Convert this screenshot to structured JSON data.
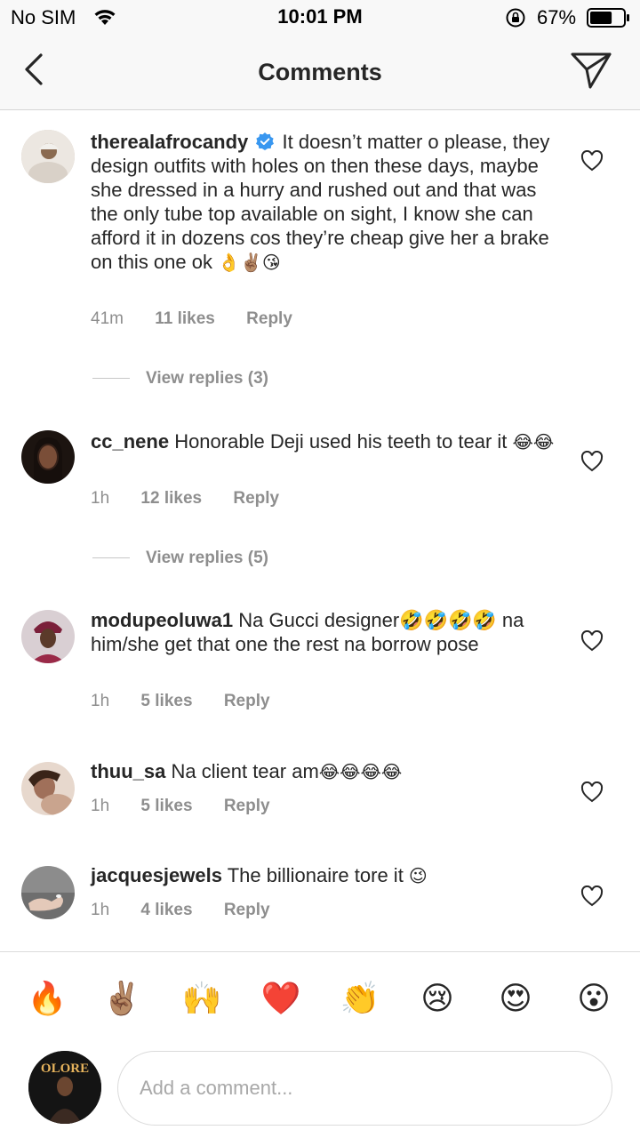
{
  "status_bar": {
    "carrier": "No SIM",
    "time": "10:01 PM",
    "battery": "67%",
    "battery_level": 0.67
  },
  "nav": {
    "title": "Comments",
    "back_icon": "chevron-left-icon",
    "send_icon": "paper-plane-icon"
  },
  "comments": [
    {
      "username": "therealafrocandy",
      "verified": true,
      "text": "It doesn’t matter o please, they design outfits with holes on then these days, maybe she dressed in a hurry and rushed out and that was the only tube top available on sight, I know she can afford it in dozens cos they’re cheap give her a brake on this one ok ",
      "emoji": "👌✌🏽😘",
      "time": "41m",
      "likes": "11 likes",
      "reply_label": "Reply",
      "view_replies": "View replies (3)"
    },
    {
      "username": "cc_nene",
      "verified": false,
      "text": "Honorable Deji used his teeth to tear it ",
      "emoji": "😂😂",
      "time": "1h",
      "likes": "12 likes",
      "reply_label": "Reply",
      "view_replies": "View replies (5)"
    },
    {
      "username": "modupeoluwa1",
      "verified": false,
      "text": "Na Gucci designer🤣🤣🤣🤣 na him/she get that one the rest na borrow pose",
      "emoji": "",
      "time": "1h",
      "likes": "5 likes",
      "reply_label": "Reply"
    },
    {
      "username": "thuu_sa",
      "verified": false,
      "text": "Na client tear am",
      "emoji": "😂😂😂😂",
      "time": "1h",
      "likes": "5 likes",
      "reply_label": "Reply"
    },
    {
      "username": "jacquesjewels",
      "verified": false,
      "text": "The billionaire tore it ",
      "emoji": "😉",
      "time": "1h",
      "likes": "4 likes",
      "reply_label": "Reply"
    }
  ],
  "emoji_bar": [
    "🔥",
    "✌🏽",
    "🙌",
    "❤️",
    "👏",
    "😢",
    "😍",
    "😮"
  ],
  "composer": {
    "placeholder": "Add a comment...",
    "avatar_text": "OLORE"
  }
}
